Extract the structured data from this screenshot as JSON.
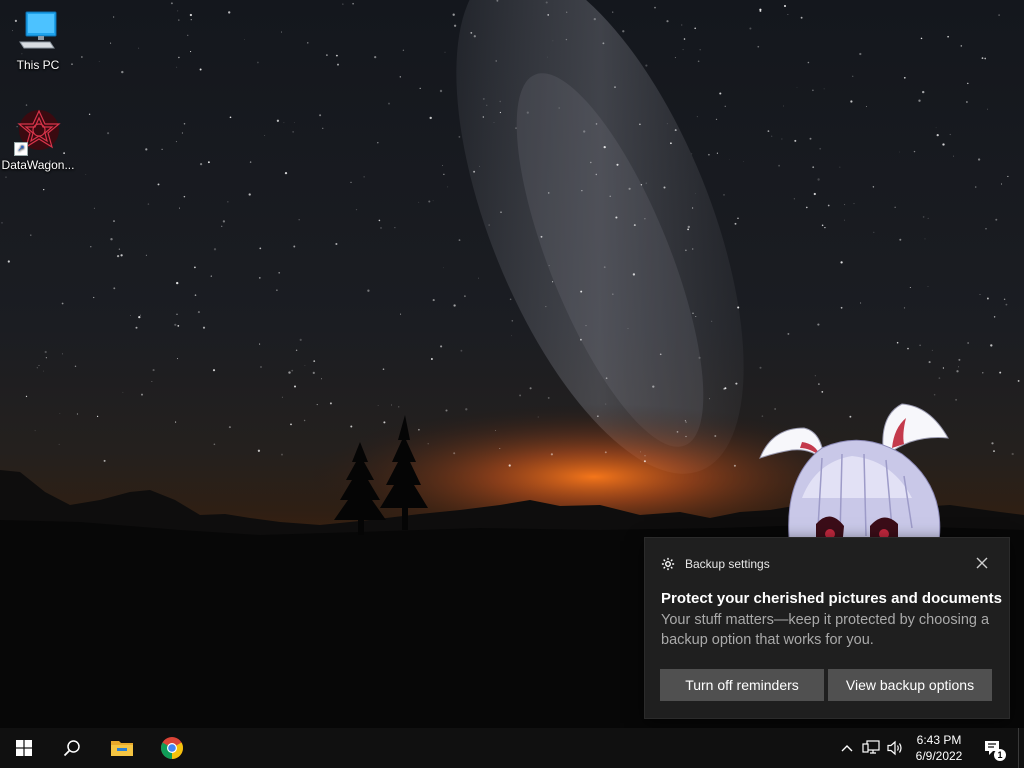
{
  "desktop": {
    "icons": [
      {
        "label": "This PC",
        "icon": "computer-icon"
      },
      {
        "label": "DataWagon...",
        "icon": "datawagon-app-icon"
      }
    ]
  },
  "toast": {
    "app_name": "Backup settings",
    "title": "Protect your cherished pictures and documents",
    "body": "Your stuff matters—keep it protected by choosing a backup option that works for you.",
    "buttons": {
      "dismiss": "Turn off reminders",
      "primary": "View backup options"
    }
  },
  "taskbar": {
    "pinned": [
      "start-icon",
      "search-icon",
      "file-explorer-icon",
      "chrome-icon"
    ],
    "tray": {
      "icons": [
        "chevron-up-icon",
        "network-icon",
        "volume-icon"
      ],
      "time": "6:43 PM",
      "date": "6/9/2022",
      "notification_count": "1"
    }
  },
  "colors": {
    "toast_bg": "#1f1f1f",
    "button_bg": "#505050",
    "taskbar_bg": "#101010",
    "horizon_glow": "#e0641e"
  }
}
